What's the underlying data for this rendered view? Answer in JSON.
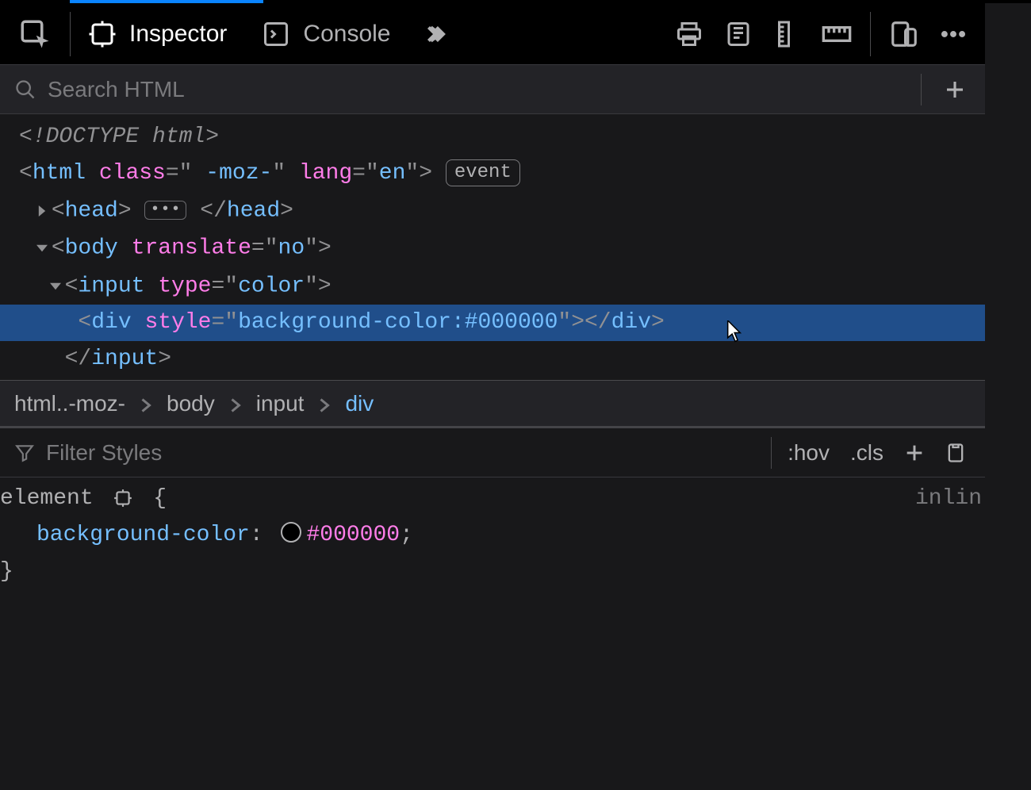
{
  "toolbar": {
    "tabs": [
      {
        "label": "Inspector",
        "active": true
      },
      {
        "label": "Console",
        "active": false
      }
    ]
  },
  "search": {
    "placeholder": "Search HTML"
  },
  "dom": {
    "doctype": "<!DOCTYPE html>",
    "html_open": {
      "class_attr": "class",
      "class_val": " -moz-",
      "lang_attr": "lang",
      "lang_val": "en",
      "event_badge": "event"
    },
    "head": {
      "open": "head",
      "close": "head"
    },
    "body": {
      "attr": "translate",
      "val": "no"
    },
    "input": {
      "attr": "type",
      "val": "color",
      "close": "input"
    },
    "div_sel": {
      "attr": "style",
      "val": "background-color:#000000",
      "close": "div"
    }
  },
  "breadcrumb": [
    {
      "label": "html..-moz-",
      "active": false
    },
    {
      "label": "body",
      "active": false
    },
    {
      "label": "input",
      "active": false
    },
    {
      "label": "div",
      "active": true
    }
  ],
  "styles_header": {
    "filter_placeholder": "Filter Styles",
    "hov": ":hov",
    "cls": ".cls"
  },
  "rule": {
    "selector": "element",
    "open_brace": "{",
    "source": "inlin",
    "prop": "background-color",
    "colon": ":",
    "value": "#000000",
    "semi": ";",
    "close_brace": "}"
  }
}
